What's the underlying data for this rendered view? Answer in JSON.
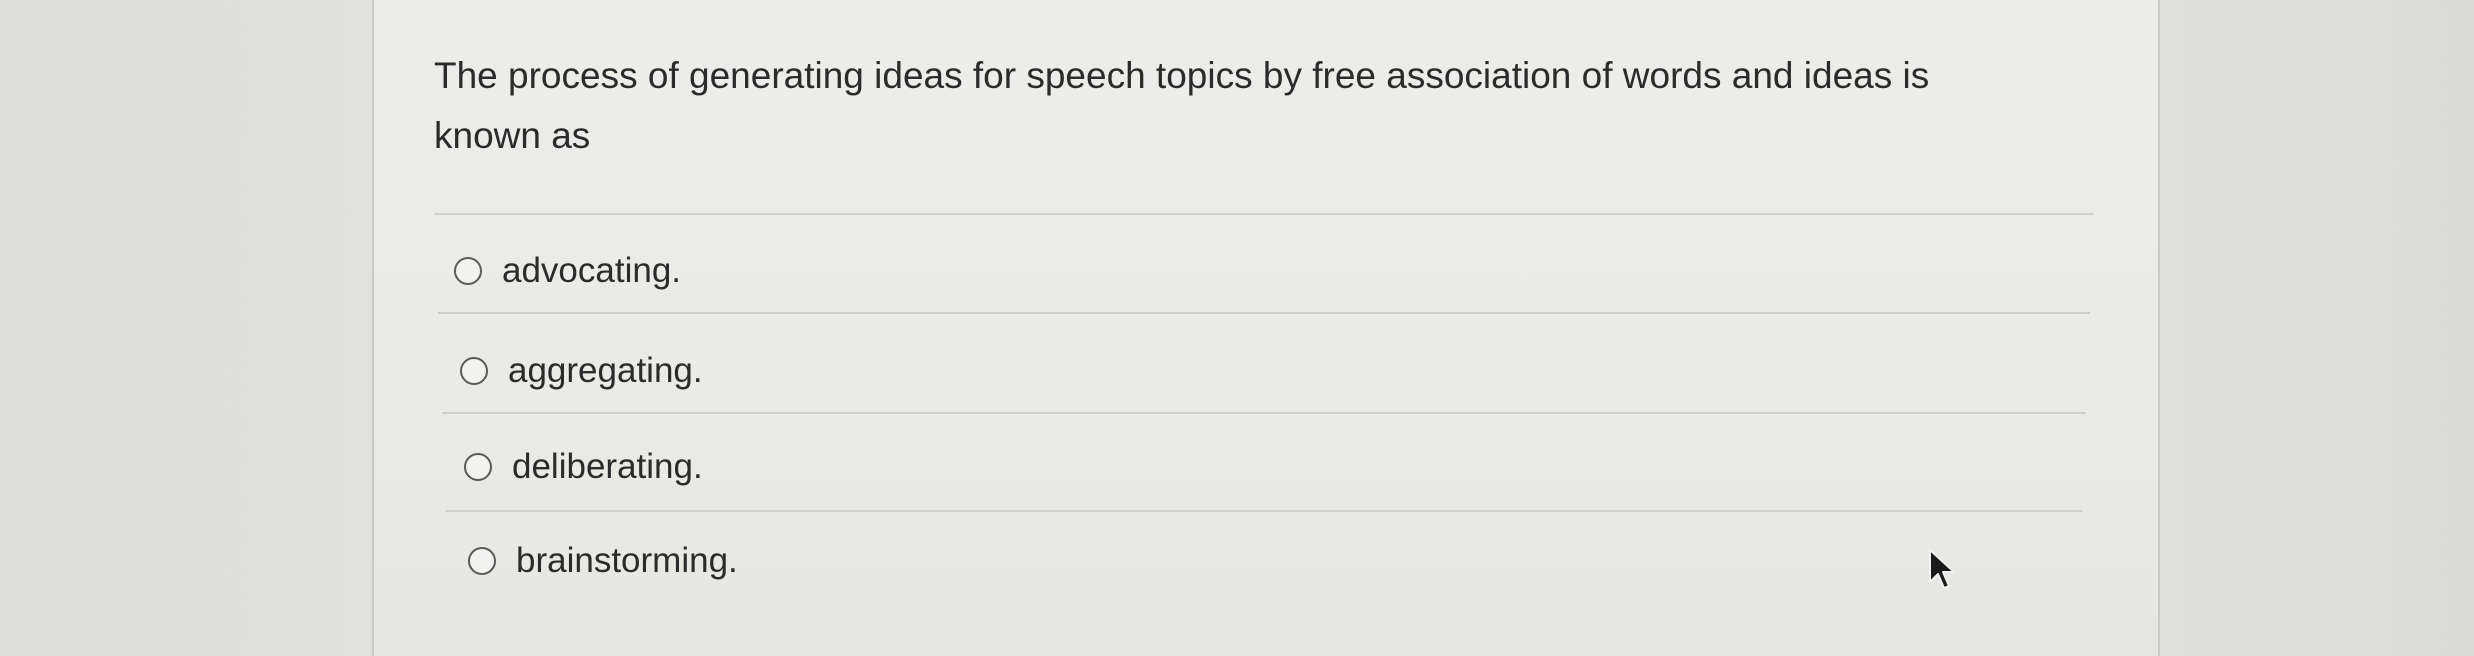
{
  "question": {
    "text": "The process of generating ideas for speech topics by free association of words and ideas is known as"
  },
  "options": [
    {
      "label": "advocating.",
      "selected": false
    },
    {
      "label": "aggregating.",
      "selected": false
    },
    {
      "label": "deliberating.",
      "selected": false
    },
    {
      "label": "brainstorming.",
      "selected": false
    }
  ],
  "cursor": {
    "icon": "mouse-pointer-icon"
  }
}
